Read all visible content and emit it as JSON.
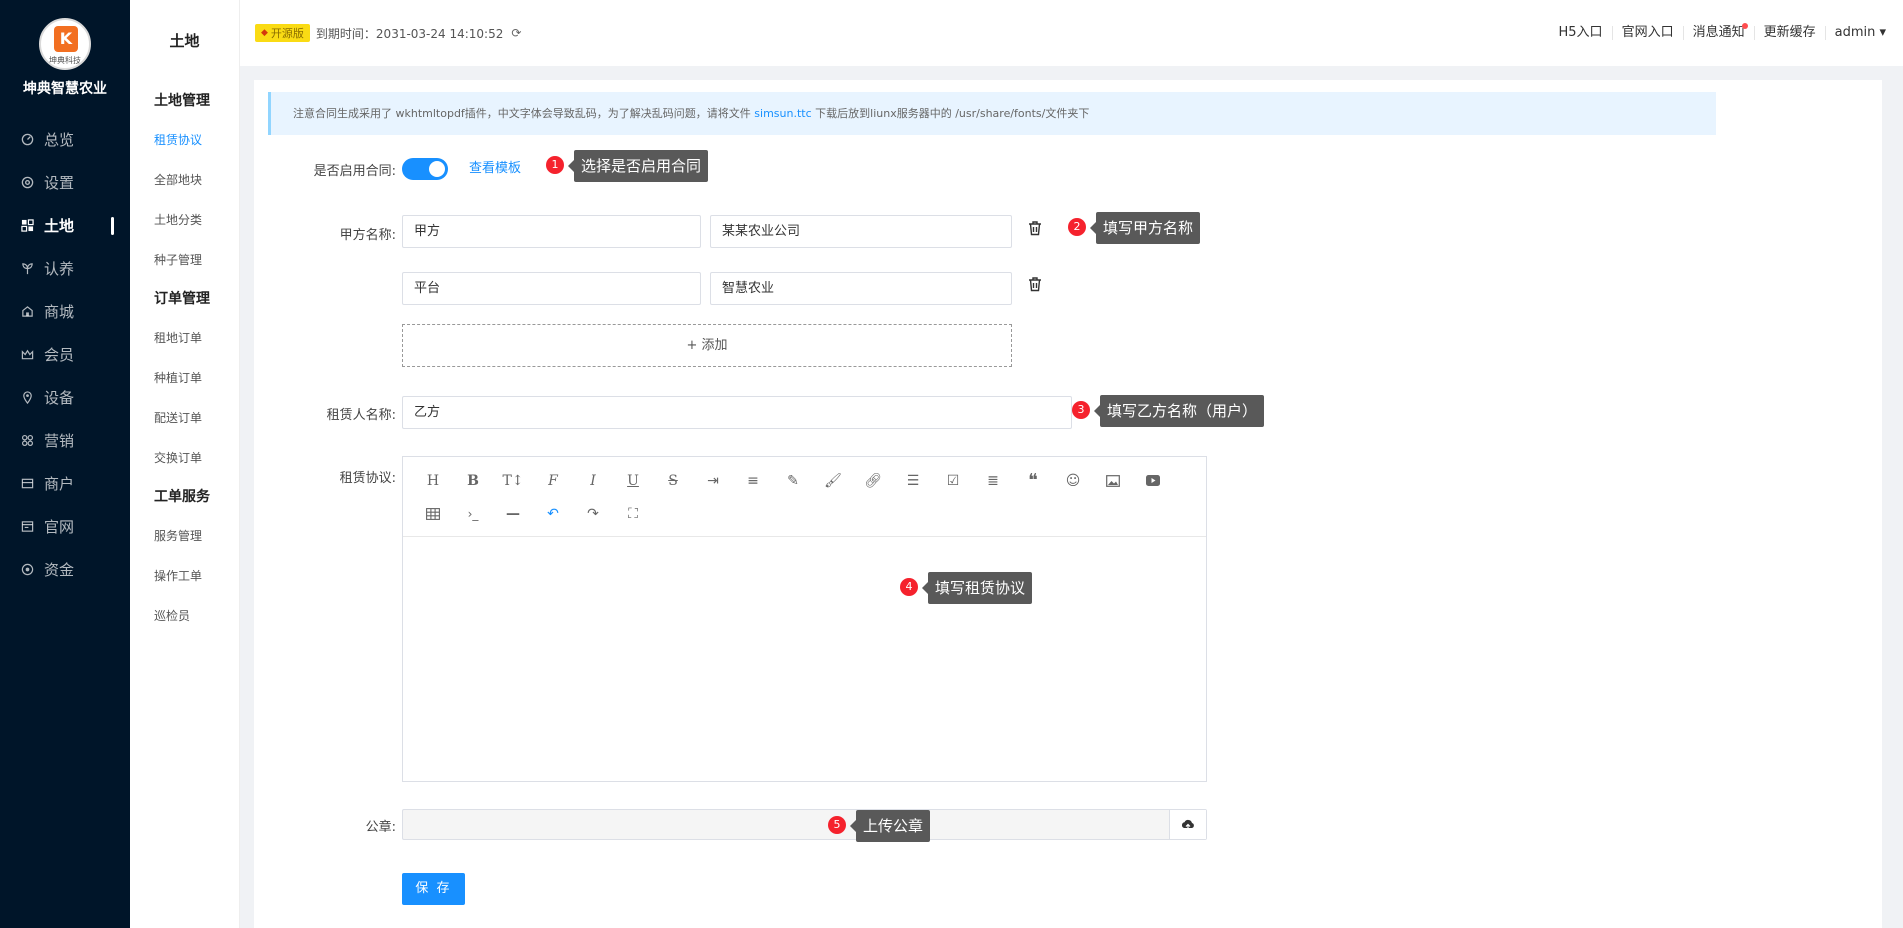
{
  "brand": {
    "logo_letter": "K",
    "logo_text": "坤典科技",
    "name": "坤典智慧农业"
  },
  "nav": [
    {
      "label": "总览",
      "icon": "dashboard-icon"
    },
    {
      "label": "设置",
      "icon": "gear-icon"
    },
    {
      "label": "土地",
      "icon": "grid-icon",
      "active": true
    },
    {
      "label": "认养",
      "icon": "sprout-icon"
    },
    {
      "label": "商城",
      "icon": "shop-icon"
    },
    {
      "label": "会员",
      "icon": "crown-icon"
    },
    {
      "label": "设备",
      "icon": "location-icon"
    },
    {
      "label": "营销",
      "icon": "apps-icon"
    },
    {
      "label": "商户",
      "icon": "store-icon"
    },
    {
      "label": "官网",
      "icon": "browser-icon"
    },
    {
      "label": "资金",
      "icon": "coin-icon"
    }
  ],
  "subnav": {
    "title": "土地",
    "groups": [
      {
        "title": "土地管理",
        "items": [
          "租赁协议",
          "全部地块",
          "土地分类",
          "种子管理"
        ]
      },
      {
        "title": "订单管理",
        "items": [
          "租地订单",
          "种植订单",
          "配送订单",
          "交换订单"
        ]
      },
      {
        "title": "工单服务",
        "items": [
          "服务管理",
          "操作工单",
          "巡检员"
        ]
      }
    ]
  },
  "header": {
    "edition": "开源版",
    "expire": "到期时间：2031-03-24 14:10:52",
    "links": [
      "H5入口",
      "官网入口",
      "消息通知",
      "更新缓存",
      "admin ▾"
    ]
  },
  "notice": {
    "text_before": "注意合同生成采用了 wkhtmltopdf插件，中文字体会导致乱码，为了解决乱码问题，请将文件 ",
    "link": "simsun.ttc",
    "text_after": " 下载后放到liunx服务器中的 /usr/share/fonts/文件夹下"
  },
  "form": {
    "enable_label": "是否启用合同:",
    "view_template": "查看模板",
    "party_a_label": "甲方名称:",
    "party_rows": [
      {
        "key": "甲方",
        "value": "某某农业公司"
      },
      {
        "key": "平台",
        "value": "智慧农业"
      }
    ],
    "add_label": "+ 添加",
    "lessee_label": "租赁人名称:",
    "lessee_value": "乙方",
    "agreement_label": "租赁协议:",
    "seal_label": "公章:",
    "save_label": "保 存"
  },
  "annotations": [
    {
      "num": "1",
      "text": "选择是否启用合同"
    },
    {
      "num": "2",
      "text": "填写甲方名称"
    },
    {
      "num": "3",
      "text": "填写乙方名称（用户）"
    },
    {
      "num": "4",
      "text": "填写租赁协议"
    },
    {
      "num": "5",
      "text": "上传公章"
    }
  ]
}
